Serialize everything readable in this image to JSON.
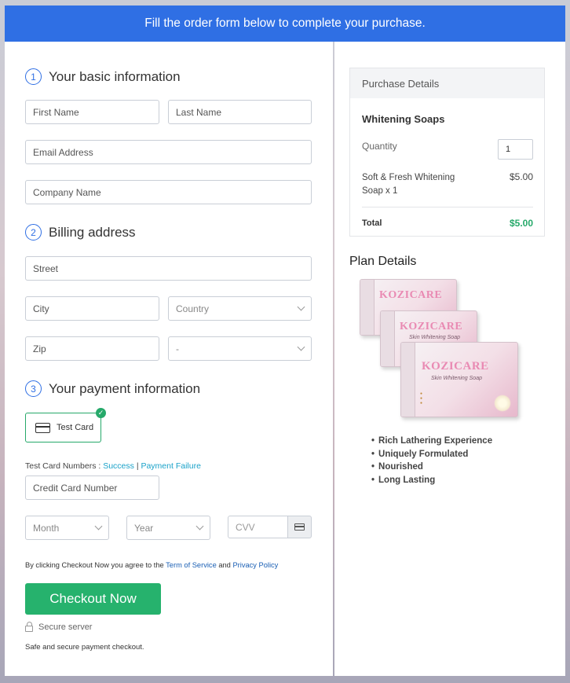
{
  "banner": {
    "text": "Fill the order form below to complete your purchase."
  },
  "sections": {
    "basic": {
      "num": "1",
      "title": "Your basic information"
    },
    "billing": {
      "num": "2",
      "title": "Billing address"
    },
    "payment": {
      "num": "3",
      "title": "Your payment information"
    }
  },
  "fields": {
    "first_name": "First Name",
    "last_name": "Last Name",
    "email": "Email Address",
    "company": "Company Name",
    "street": "Street",
    "city": "City",
    "country": "Country",
    "zip": "Zip",
    "state": "-",
    "card_number": "Credit Card Number",
    "month": "Month",
    "year": "Year",
    "cvv": "CVV"
  },
  "payment": {
    "card_label": "Test Card",
    "test_numbers_label": "Test Card Numbers :",
    "success_link": "Success",
    "separator": "|",
    "failure_link": "Payment Failure"
  },
  "terms": {
    "prefix": "By clicking Checkout Now you agree to the",
    "terms_link": "Term of Service",
    "and": "and",
    "privacy_link": "Privacy Policy"
  },
  "checkout": {
    "button_label": "Checkout Now",
    "secure_label": "Secure server",
    "safe_text": "Safe and secure payment checkout."
  },
  "purchase": {
    "header": "Purchase Details",
    "product_name": "Whitening Soaps",
    "quantity_label": "Quantity",
    "quantity_value": "1",
    "item_label": "Soft & Fresh Whitening Soap x 1",
    "item_price": "$5.00",
    "total_label": "Total",
    "total_value": "$5.00",
    "total_color": "#26a96a"
  },
  "plan": {
    "title": "Plan Details",
    "image": {
      "brand": "KOZICARE",
      "subtitle": "Skin Whitening Soap"
    },
    "features": [
      "Rich Lathering Experience",
      "Uniquely Formulated",
      "Nourished",
      "Long Lasting"
    ]
  },
  "colors": {
    "accent": "#2f6fe4",
    "success": "#26b26d",
    "link": "#1aa2c9"
  }
}
